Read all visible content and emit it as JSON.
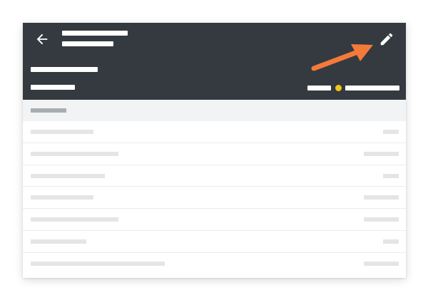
{
  "theme": {
    "header_bg": "#343a40",
    "accent": "#f47a3a",
    "status_color": "#f5c518"
  },
  "header": {
    "back_icon": "arrow-left-icon",
    "edit_icon": "pencil-icon",
    "title": "",
    "subtitle": "",
    "name": "",
    "detail": "",
    "status_label": "",
    "status_value": ""
  },
  "annotation": {
    "icon": "orange-arrow-pointer-icon",
    "target": "edit-button"
  },
  "section": {
    "label": ""
  },
  "rows": [
    {
      "primary": "",
      "secondary": ""
    },
    {
      "primary": "",
      "secondary": ""
    },
    {
      "primary": "",
      "secondary": ""
    },
    {
      "primary": "",
      "secondary": ""
    },
    {
      "primary": "",
      "secondary": ""
    },
    {
      "primary": "",
      "secondary": ""
    },
    {
      "primary": "",
      "secondary": ""
    }
  ]
}
